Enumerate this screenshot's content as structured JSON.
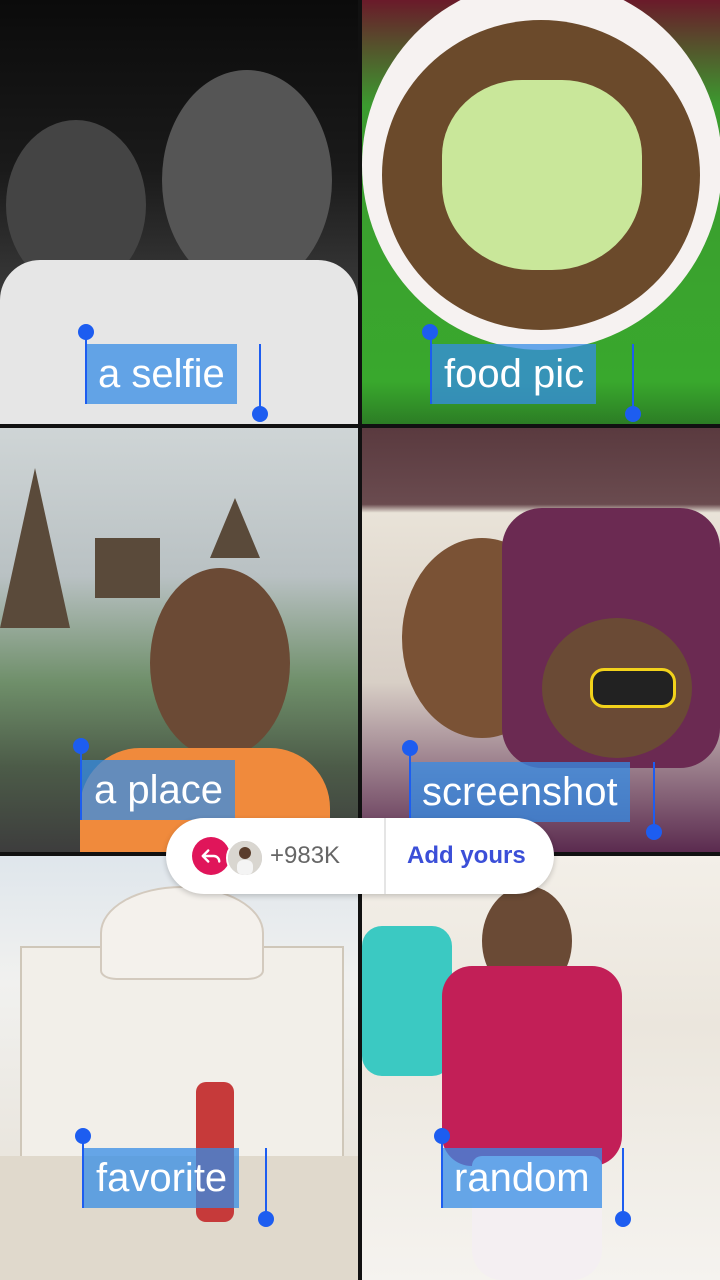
{
  "tiles": [
    {
      "label": "a selfie"
    },
    {
      "label": "food pic"
    },
    {
      "label": "a place"
    },
    {
      "label": "screenshot"
    },
    {
      "label": "favorite"
    },
    {
      "label": "random"
    }
  ],
  "sticker": {
    "count": "+983K",
    "add_label": "Add yours",
    "reply_icon": "reply-arrow-icon"
  },
  "colors": {
    "label_bg": "#368ce6",
    "handle": "#1d5df0",
    "reply_badge": "#e0155a",
    "add_text": "#3b4fd8"
  }
}
